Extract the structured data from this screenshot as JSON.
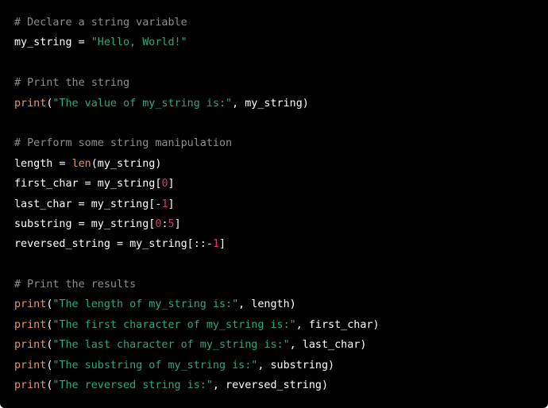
{
  "code_block": {
    "language": "python",
    "colors": {
      "background": "#000000",
      "comment": "#8e8e8e",
      "string": "#2ea77d",
      "builtin": "#e0956a",
      "number": "#df3079",
      "plain": "#ffffff"
    },
    "lines": [
      [
        {
          "t": "comment",
          "v": "# Declare a string variable"
        }
      ],
      [
        {
          "t": "plain",
          "v": "my_string = "
        },
        {
          "t": "string",
          "v": "\"Hello, World!\""
        }
      ],
      [],
      [
        {
          "t": "comment",
          "v": "# Print the string"
        }
      ],
      [
        {
          "t": "builtin",
          "v": "print"
        },
        {
          "t": "plain",
          "v": "("
        },
        {
          "t": "string",
          "v": "\"The value of my_string is:\""
        },
        {
          "t": "plain",
          "v": ", my_string)"
        }
      ],
      [],
      [
        {
          "t": "comment",
          "v": "# Perform some string manipulation"
        }
      ],
      [
        {
          "t": "plain",
          "v": "length = "
        },
        {
          "t": "builtin",
          "v": "len"
        },
        {
          "t": "plain",
          "v": "(my_string)"
        }
      ],
      [
        {
          "t": "plain",
          "v": "first_char = my_string["
        },
        {
          "t": "number",
          "v": "0"
        },
        {
          "t": "plain",
          "v": "]"
        }
      ],
      [
        {
          "t": "plain",
          "v": "last_char = my_string[-"
        },
        {
          "t": "number",
          "v": "1"
        },
        {
          "t": "plain",
          "v": "]"
        }
      ],
      [
        {
          "t": "plain",
          "v": "substring = my_string["
        },
        {
          "t": "number",
          "v": "0"
        },
        {
          "t": "plain",
          "v": ":"
        },
        {
          "t": "number",
          "v": "5"
        },
        {
          "t": "plain",
          "v": "]"
        }
      ],
      [
        {
          "t": "plain",
          "v": "reversed_string = my_string[::-"
        },
        {
          "t": "number",
          "v": "1"
        },
        {
          "t": "plain",
          "v": "]"
        }
      ],
      [],
      [
        {
          "t": "comment",
          "v": "# Print the results"
        }
      ],
      [
        {
          "t": "builtin",
          "v": "print"
        },
        {
          "t": "plain",
          "v": "("
        },
        {
          "t": "string",
          "v": "\"The length of my_string is:\""
        },
        {
          "t": "plain",
          "v": ", length)"
        }
      ],
      [
        {
          "t": "builtin",
          "v": "print"
        },
        {
          "t": "plain",
          "v": "("
        },
        {
          "t": "string",
          "v": "\"The first character of my_string is:\""
        },
        {
          "t": "plain",
          "v": ", first_char)"
        }
      ],
      [
        {
          "t": "builtin",
          "v": "print"
        },
        {
          "t": "plain",
          "v": "("
        },
        {
          "t": "string",
          "v": "\"The last character of my_string is:\""
        },
        {
          "t": "plain",
          "v": ", last_char)"
        }
      ],
      [
        {
          "t": "builtin",
          "v": "print"
        },
        {
          "t": "plain",
          "v": "("
        },
        {
          "t": "string",
          "v": "\"The substring of my_string is:\""
        },
        {
          "t": "plain",
          "v": ", substring)"
        }
      ],
      [
        {
          "t": "builtin",
          "v": "print"
        },
        {
          "t": "plain",
          "v": "("
        },
        {
          "t": "string",
          "v": "\"The reversed string is:\""
        },
        {
          "t": "plain",
          "v": ", reversed_string)"
        }
      ]
    ]
  }
}
